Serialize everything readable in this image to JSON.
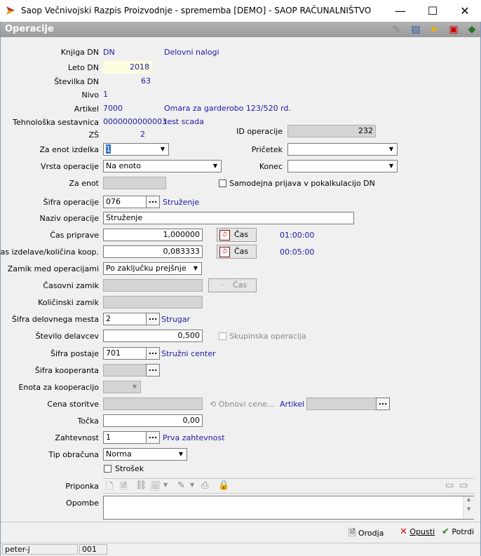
{
  "window": {
    "title": "Saop   Večnivojski Razpis Proizvodnje - sprememba [DEMO] - SAOP RAČUNALNIŠTVO",
    "minimize": "—",
    "maximize": "☐",
    "close": "✕"
  },
  "header": {
    "title": "Operacije"
  },
  "fields": {
    "knjiga_dn": {
      "label": "Knjiga DN",
      "code": "DN",
      "name": "Delovni nalogi"
    },
    "leto_dn": {
      "label": "Leto DN",
      "value": "2018"
    },
    "stevilka_dn": {
      "label": "Številka DN",
      "value": "63"
    },
    "nivo": {
      "label": "Nivo",
      "value": "1"
    },
    "artikel": {
      "label": "Artikel",
      "code": "7000",
      "name": "Omara za garderobo 123/520 rd."
    },
    "tehnoloska_sestavnica": {
      "label": "Tehnološka sestavnica",
      "code": "0000000000003",
      "name": "test scada"
    },
    "zs": {
      "label": "ZŠ",
      "value": "2"
    },
    "id_operacije": {
      "label": "ID operacije",
      "value": "232"
    },
    "za_enot_izdelka": {
      "label": "Za enot izdelka",
      "value": "1"
    },
    "pricetek": {
      "label": "Pričetek",
      "value": ""
    },
    "vrsta_operacije": {
      "label": "Vrsta operacije",
      "value": "Na enoto"
    },
    "konec": {
      "label": "Konec",
      "value": ""
    },
    "za_enot": {
      "label": "Za enot",
      "value": ""
    },
    "samodejna_prijava": {
      "label": "Samodejna prijava v pokalkulacijo DN"
    },
    "sifra_operacije": {
      "label": "Šifra operacije",
      "value": "076",
      "name": "Struženje"
    },
    "naziv_operacije": {
      "label": "Naziv operacije",
      "value": "Struženje"
    },
    "cas_priprave": {
      "label": "Čas priprave",
      "value": "1,000000",
      "button": "Čas",
      "time": "01:00:00"
    },
    "cas_izdelave": {
      "label": "Čas izdelave/količina koop.",
      "value": "0,083333",
      "button": "Čas",
      "time": "00:05:00"
    },
    "zamik_med_operacijami": {
      "label": "Zamik med operacijami",
      "value": "Po zaključku prejšnje"
    },
    "casovni_zamik": {
      "label": "Časovni zamik",
      "value": "",
      "button": "Čas"
    },
    "kolicinski_zamik": {
      "label": "Količinski zamik",
      "value": ""
    },
    "sifra_delovnega_mesta": {
      "label": "Šifra delovnega mesta",
      "value": "2",
      "name": "Strugar"
    },
    "stevilo_delavcev": {
      "label": "Število delavcev",
      "value": "0,500"
    },
    "skupinska_operacija": {
      "label": "Skupinska operacija"
    },
    "sifra_postaje": {
      "label": "Šifra postaje",
      "value": "701",
      "name": "Stružni center"
    },
    "sifra_kooperanta": {
      "label": "Šifra kooperanta",
      "value": ""
    },
    "enota_za_kooperacijo": {
      "label": "Enota za kooperacijo",
      "value": ""
    },
    "cena_storitve": {
      "label": "Cena storitve",
      "value": "",
      "button": "Obnovi cene...",
      "artikel_label": "Artikel",
      "artikel_value": ""
    },
    "tocka": {
      "label": "Točka",
      "value": "0,00"
    },
    "zahtevnost": {
      "label": "Zahtevnost",
      "value": "1",
      "name": "Prva zahtevnost"
    },
    "tip_obracuna": {
      "label": "Tip obračuna",
      "value": "Norma"
    },
    "strosek": {
      "label": "Strošek"
    },
    "priponka": {
      "label": "Priponka"
    },
    "opombe": {
      "label": "Opombe",
      "value": ""
    }
  },
  "buttons": {
    "orodja": "Orodja",
    "opusti": "Opusti",
    "potrdi": "Potrdi"
  },
  "status": {
    "user": "peter-j",
    "code": "001"
  }
}
